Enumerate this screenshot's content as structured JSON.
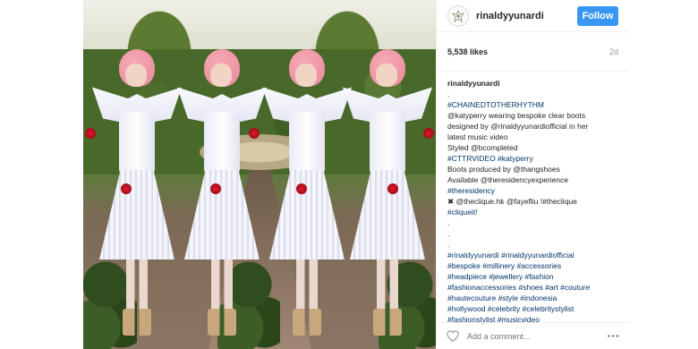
{
  "header": {
    "username": "rinaldyyunardi",
    "follow_label": "Follow"
  },
  "meta": {
    "likes": "5,538 likes",
    "time": "2d"
  },
  "caption": {
    "lines": [
      {
        "text": "rinaldyyunardi",
        "style": "user"
      },
      {
        "text": ".",
        "style": "plain"
      },
      {
        "text": "#CHAINEDTOTHERHYTHM",
        "style": "link"
      },
      {
        "text": "@katyperry wearing bespoke clear boots",
        "style": "plain"
      },
      {
        "text": "designed by @rinaldyyunardiofficial in her",
        "style": "plain"
      },
      {
        "text": "latest music video",
        "style": "plain"
      },
      {
        "text": "Styled @bcompleted",
        "style": "plain"
      },
      {
        "text": "#CTTRVIDEO #katyperry",
        "style": "link"
      },
      {
        "text": "Boots produced by @thangshoes",
        "style": "plain"
      },
      {
        "text": "Available @theresidencyexperience",
        "style": "plain"
      },
      {
        "text": "#theresidency",
        "style": "link"
      },
      {
        "text": "✖ @theclique.hk @fayefliu !#theclique",
        "style": "plain"
      },
      {
        "text": "#cliqueit!",
        "style": "link"
      },
      {
        "text": ".",
        "style": "plain"
      },
      {
        "text": ".",
        "style": "plain"
      },
      {
        "text": ".",
        "style": "plain"
      },
      {
        "text": "#rinaldyyunardi #rinaldyyunardiofficial",
        "style": "link"
      },
      {
        "text": "#bespoke #millinery #accessories",
        "style": "link"
      },
      {
        "text": "#headpiece #jewellery #fashion",
        "style": "link"
      },
      {
        "text": "#fashionaccessories #shoes #art #couture",
        "style": "link"
      },
      {
        "text": "#hautecouture #style #indonesia",
        "style": "link"
      },
      {
        "text": "#hollywood #celebrity #celebritystylist",
        "style": "link"
      },
      {
        "text": "#fashionstylist #musicvideo",
        "style": "link"
      }
    ]
  },
  "comment": {
    "placeholder": "Add a comment...",
    "more_label": "•••"
  },
  "colors": {
    "follow_blue": "#3897f0",
    "link": "#003569"
  },
  "icons": {
    "heart": "heart-icon",
    "avatar": "avatar-logo-icon"
  }
}
